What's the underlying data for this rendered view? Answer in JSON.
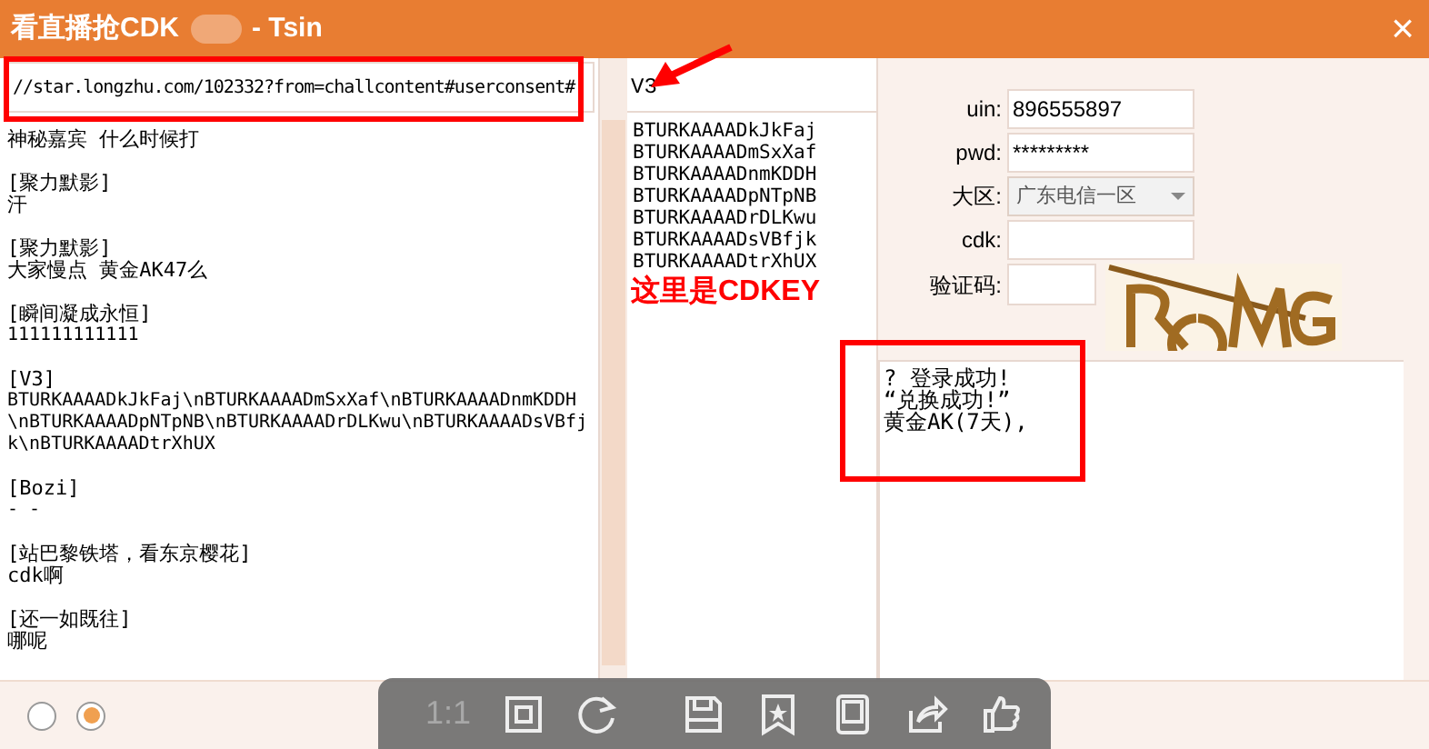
{
  "window": {
    "title": "看直播抢CDK",
    "title_suffix": "- Tsin",
    "close": "×"
  },
  "url_field": {
    "value": "//star.longzhu.com/102332?from=challcontent#userconsent#"
  },
  "chat": [
    {
      "text": "神秘嘉宾 什么时候打"
    },
    {
      "name": "[聚力默影]",
      "text": "汗"
    },
    {
      "name": "[聚力默影]",
      "text": "大家慢点 黄金AK47么"
    },
    {
      "name": "[瞬间凝成永恒]",
      "text": "111111111111"
    },
    {
      "name": "[V3]",
      "text": "BTURKAAAADkJkFaj\\nBTURKAAAADmSxXaf\\nBTURKAAAADnmKDDH\\nBTURKAAAADpNTpNB\\nBTURKAAAADrDLKwu\\nBTURKAAAADsVBfjk\\nBTURKAAAADtrXhUX"
    },
    {
      "name": "[Bozi]",
      "text": "- -"
    },
    {
      "name": "[站巴黎铁塔，看东京樱花]",
      "text": "cdk啊"
    },
    {
      "name": "[还一如既往]",
      "text": "哪呢"
    }
  ],
  "filter_field": {
    "value": "V3"
  },
  "codes": [
    "BTURKAAAADkJkFaj",
    "BTURKAAAADmSxXaf",
    "BTURKAAAADnmKDDH",
    "BTURKAAAADpNTpNB",
    "BTURKAAAADrDLKwu",
    "BTURKAAAADsVBfjk",
    "BTURKAAAADtrXhUX"
  ],
  "form": [
    {
      "label": "uin:",
      "kind": "text",
      "value": "896555897"
    },
    {
      "label": "pwd:",
      "kind": "text",
      "value": "*********"
    },
    {
      "label": "大区:",
      "kind": "select",
      "value": "广东电信一区"
    },
    {
      "label": "cdk:",
      "kind": "text"
    },
    {
      "label": "验证码:",
      "kind": "captcha"
    }
  ],
  "log": [
    "? 登录成功!",
    "“兑换成功!”",
    "黄金AK(7天),"
  ],
  "annotation": {
    "label": "这里是CDKEY"
  },
  "radios": [
    {
      "selected": false
    },
    {
      "selected": true
    }
  ],
  "viewer_toolbar": {
    "zoom_label": "1:1"
  }
}
